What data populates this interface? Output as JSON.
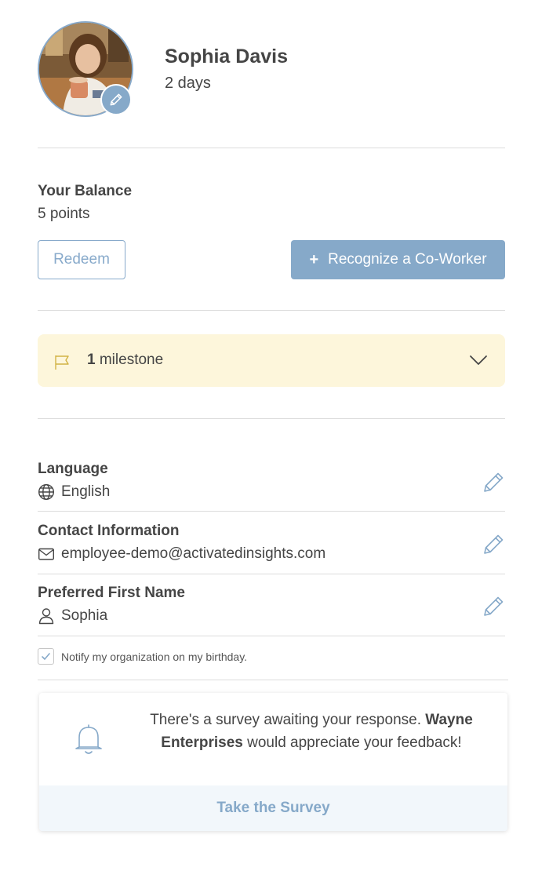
{
  "profile": {
    "name": "Sophia Davis",
    "tenure": "2 days"
  },
  "balance": {
    "title": "Your Balance",
    "value": "5 points",
    "redeem_label": "Redeem",
    "recognize_icon": "+",
    "recognize_label": "Recognize a Co-Worker"
  },
  "milestone": {
    "count": "1",
    "label": "milestone",
    "icon": "flag-icon",
    "accent": "#fdf6db"
  },
  "settings": {
    "language": {
      "title": "Language",
      "value": "English",
      "icon": "globe-icon"
    },
    "contact": {
      "title": "Contact Information",
      "value": "employee-demo@activatedinsights.com",
      "icon": "mail-icon"
    },
    "preferred_name": {
      "title": "Preferred First Name",
      "value": "Sophia",
      "icon": "user-icon"
    }
  },
  "birthday": {
    "label": "Notify my organization on my birthday.",
    "checked": true
  },
  "survey": {
    "message_prefix": "There's a survey awaiting your response.",
    "organization": "Wayne Enterprises",
    "message_suffix": "would appreciate your feedback!",
    "cta_label": "Take the Survey"
  },
  "colors": {
    "accent_blue": "#86a9c9",
    "milestone_bg": "#fdf6db",
    "survey_cta_bg": "#f2f7fb",
    "text": "#454545"
  }
}
